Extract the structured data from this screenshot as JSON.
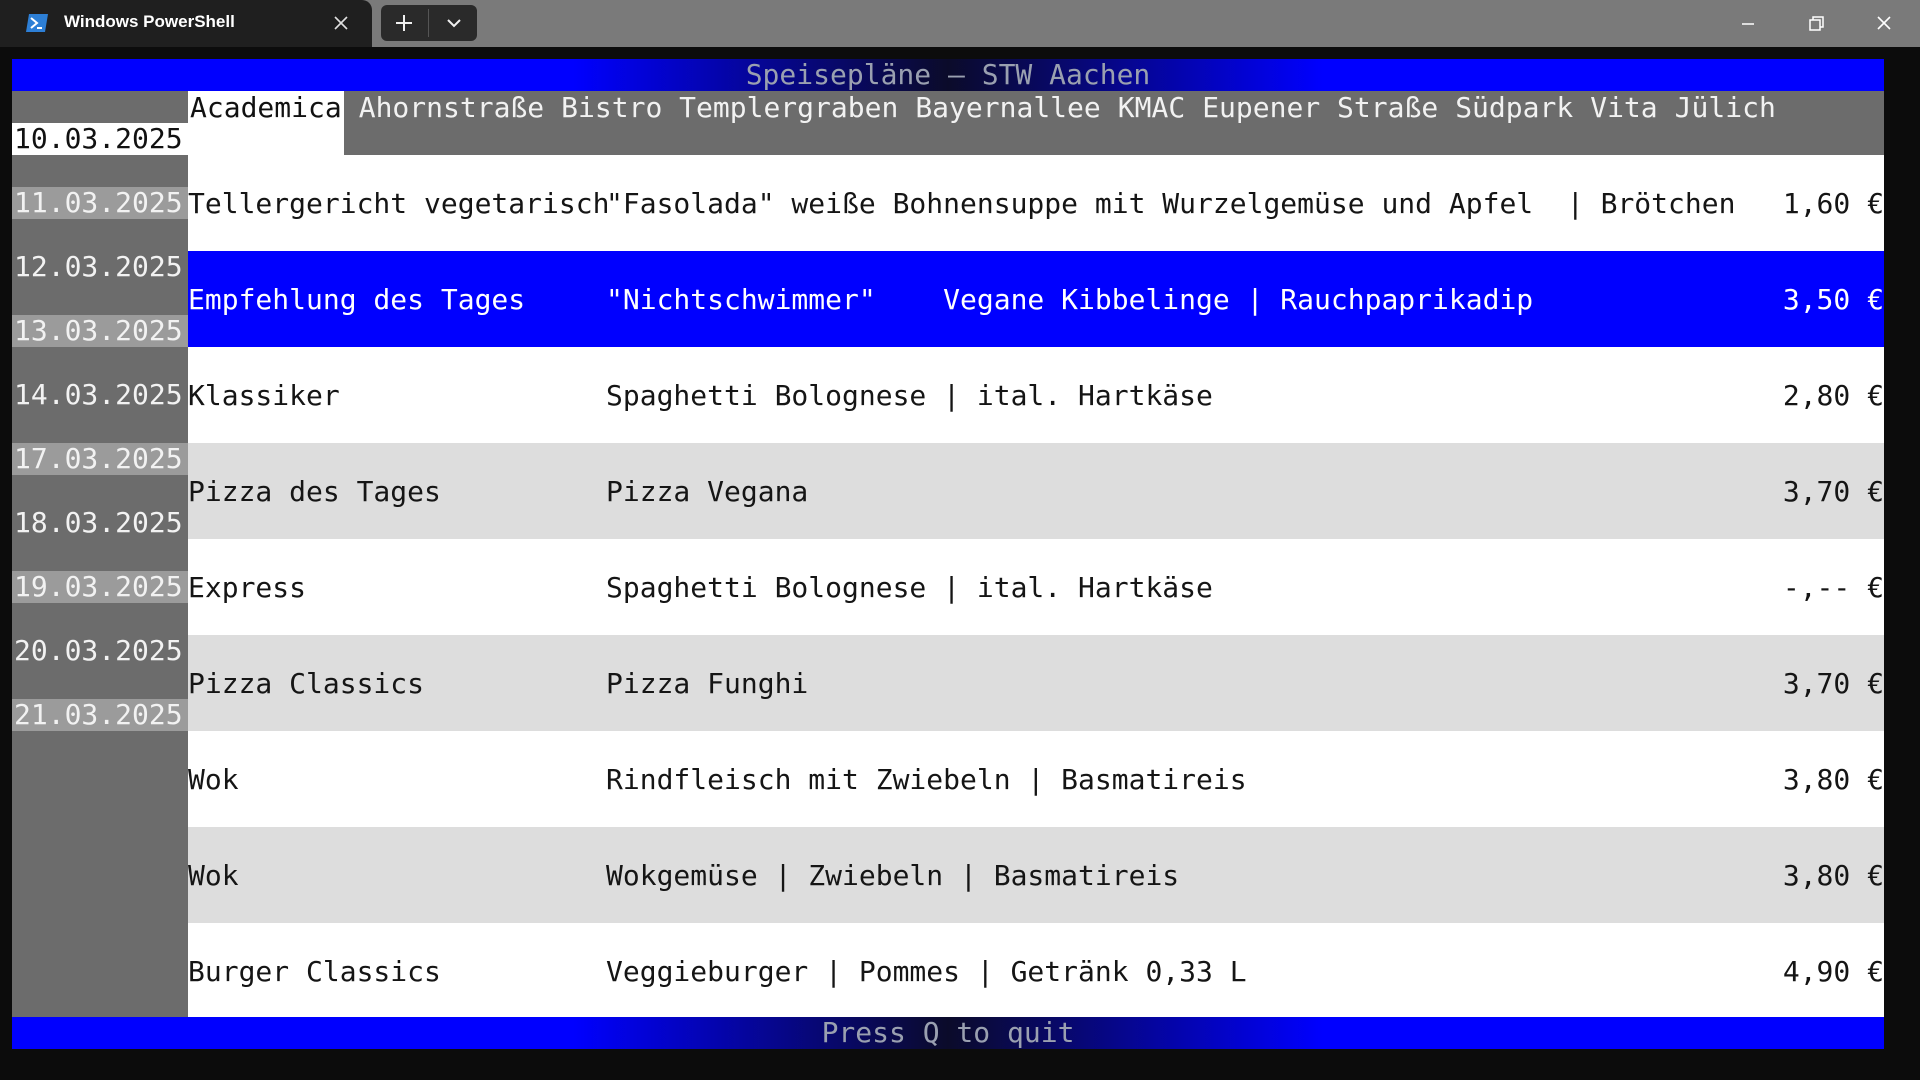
{
  "window": {
    "tab_title": "Windows PowerShell",
    "icons": {
      "tab_icon": "powershell-icon",
      "tab_close": "close-icon",
      "new_tab": "plus-icon",
      "dropdown": "chevron-down-icon",
      "minimize": "minimize-icon",
      "maximize": "restore-icon",
      "close": "close-icon"
    }
  },
  "app": {
    "title": "Speisepläne — STW Aachen",
    "footer": "Press Q to quit",
    "accent_color": "#0000ff",
    "dates": [
      {
        "label": "10.03.2025",
        "state": "selected"
      },
      {
        "label": "11.03.2025",
        "state": "alt"
      },
      {
        "label": "12.03.2025",
        "state": "normal"
      },
      {
        "label": "13.03.2025",
        "state": "alt"
      },
      {
        "label": "14.03.2025",
        "state": "normal"
      },
      {
        "label": "17.03.2025",
        "state": "alt"
      },
      {
        "label": "18.03.2025",
        "state": "normal"
      },
      {
        "label": "19.03.2025",
        "state": "alt"
      },
      {
        "label": "20.03.2025",
        "state": "normal"
      },
      {
        "label": "21.03.2025",
        "state": "alt"
      }
    ],
    "locations": [
      {
        "label": "Academica",
        "active": true
      },
      {
        "label": "Ahornstraße",
        "active": false
      },
      {
        "label": "Bistro Templergraben",
        "active": false
      },
      {
        "label": "Bayernallee",
        "active": false
      },
      {
        "label": "KMAC",
        "active": false
      },
      {
        "label": "Eupener Straße",
        "active": false
      },
      {
        "label": "Südpark",
        "active": false
      },
      {
        "label": "Vita",
        "active": false
      },
      {
        "label": "Jülich",
        "active": false
      }
    ],
    "meals": [
      {
        "category": "Tellergericht vegetarisch",
        "description": "\"Fasolada\" weiße Bohnensuppe mit Wurzelgemüse und Apfel  | Brötchen",
        "price": "1,60 €",
        "state": "normal"
      },
      {
        "category": "Empfehlung des Tages",
        "description": "\"Nichtschwimmer\"    Vegane Kibbelinge | Rauchpaprikadip",
        "price": "3,50 €",
        "state": "selected"
      },
      {
        "category": "Klassiker",
        "description": "Spaghetti Bolognese | ital. Hartkäse",
        "price": "2,80 €",
        "state": "normal"
      },
      {
        "category": "Pizza des Tages",
        "description": "Pizza Vegana",
        "price": "3,70 €",
        "state": "alt"
      },
      {
        "category": "Express",
        "description": "Spaghetti Bolognese | ital. Hartkäse",
        "price": "-,-- €",
        "state": "normal"
      },
      {
        "category": "Pizza Classics",
        "description": "Pizza Funghi",
        "price": "3,70 €",
        "state": "alt"
      },
      {
        "category": "Wok",
        "description": "Rindfleisch mit Zwiebeln | Basmatireis",
        "price": "3,80 €",
        "state": "normal"
      },
      {
        "category": "Wok",
        "description": "Wokgemüse | Zwiebeln | Basmatireis",
        "price": "3,80 €",
        "state": "alt"
      },
      {
        "category": "Burger Classics",
        "description": "Veggieburger | Pommes | Getränk 0,33 L",
        "price": "4,90 €",
        "state": "normal"
      }
    ]
  }
}
